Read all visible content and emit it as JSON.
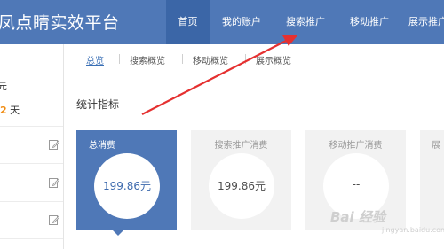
{
  "header": {
    "logo_text": "凤点睛实效平台",
    "nav": [
      {
        "label": "首页"
      },
      {
        "label": "我的账户"
      },
      {
        "label": "搜索推广"
      },
      {
        "label": "移动推广"
      },
      {
        "label": "展示推广"
      }
    ]
  },
  "sidebar": {
    "text1": "元",
    "row2_num": "2",
    "row2_unit": "天"
  },
  "subtabs": [
    {
      "label": "总览"
    },
    {
      "label": "搜索概览"
    },
    {
      "label": "移动概览"
    },
    {
      "label": "展示概览"
    }
  ],
  "section_title": "统计指标",
  "cards": [
    {
      "title": "总消费",
      "value": "199.86元"
    },
    {
      "title": "搜索推广消费",
      "value": "199.86元"
    },
    {
      "title": "移动推广消费",
      "value": "--"
    },
    {
      "title": "展",
      "value": ""
    }
  ],
  "watermark": {
    "text": "Bai 经验",
    "sub": "jingyan.baidu.com"
  },
  "colors": {
    "header": "#4f78b7",
    "active_nav": "#3b66a7",
    "annotation_arrow": "#e53030",
    "badge": "#f08c12"
  }
}
